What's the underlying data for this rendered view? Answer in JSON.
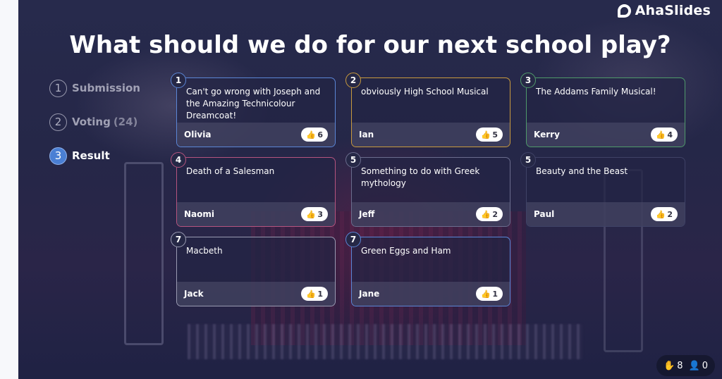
{
  "brand": {
    "name": "AhaSlides"
  },
  "question": {
    "title": "What should we do for our next school play?"
  },
  "steps": [
    {
      "number": "1",
      "label": "Submission",
      "count": "",
      "active": false
    },
    {
      "number": "2",
      "label": "Voting",
      "count": "(24)",
      "active": false
    },
    {
      "number": "3",
      "label": "Result",
      "count": "",
      "active": true
    }
  ],
  "ideas": [
    {
      "rank": "1",
      "text": "Can't go wrong with Joseph and the Amazing Technicolour Dreamcoat!",
      "author": "Olivia",
      "votes": "6",
      "border_color": "#5b86d6"
    },
    {
      "rank": "2",
      "text": "obviously High School Musical",
      "author": "Ian",
      "votes": "5",
      "border_color": "#c99a3e"
    },
    {
      "rank": "3",
      "text": "The Addams Family Musical!",
      "author": "Kerry",
      "votes": "4",
      "border_color": "#4f9a6a"
    },
    {
      "rank": "4",
      "text": "Death of a Salesman",
      "author": "Naomi",
      "votes": "3",
      "border_color": "#b5547f"
    },
    {
      "rank": "5",
      "text": "Something to do with Greek mythology",
      "author": "Jeff",
      "votes": "2",
      "border_color": "#6b6d8e"
    },
    {
      "rank": "5",
      "text": "Beauty and the Beast",
      "author": "Paul",
      "votes": "2",
      "border_color": "#3f4266"
    },
    {
      "rank": "7",
      "text": "Macbeth",
      "author": "Jack",
      "votes": "1",
      "border_color": "#9a9bb2"
    },
    {
      "rank": "7",
      "text": "Green Eggs and Ham",
      "author": "Jane",
      "votes": "1",
      "border_color": "#5b86d6"
    }
  ],
  "status": {
    "reactions_icon": "raised-hand-icon",
    "reactions": "8",
    "participants_icon": "person-icon",
    "participants": "0"
  },
  "icons": {
    "like": "thumbs-up-icon",
    "logo": "ahaslides-logo-icon"
  }
}
